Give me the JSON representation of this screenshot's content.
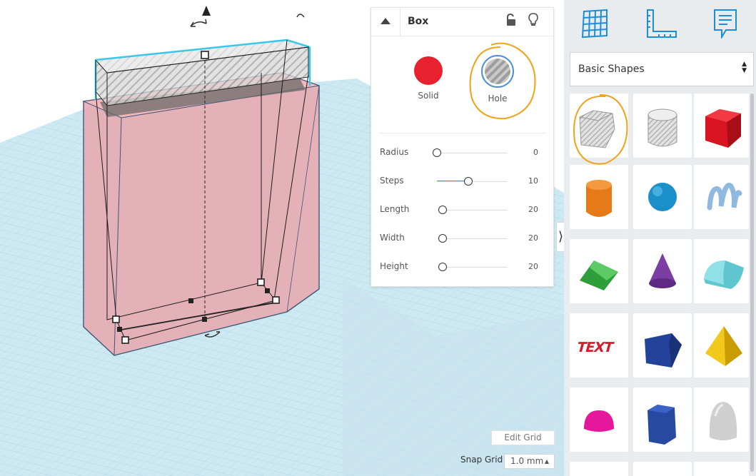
{
  "inspector": {
    "title": "Box",
    "solid_label": "Solid",
    "hole_label": "Hole",
    "colors": {
      "solid": "#e8212f",
      "hole_ring": "#4a90d9",
      "annotation": "#f0a21a"
    },
    "properties": [
      {
        "label": "Radius",
        "value": "0",
        "level": 0.0
      },
      {
        "label": "Steps",
        "value": "10",
        "level": 0.45
      },
      {
        "label": "Length",
        "value": "20",
        "level": 0.08
      },
      {
        "label": "Width",
        "value": "20",
        "level": 0.08
      },
      {
        "label": "Height",
        "value": "20",
        "level": 0.08
      }
    ]
  },
  "workplane": {
    "edit_grid_label": "Edit Grid",
    "snap_grid_label": "Snap Grid",
    "snap_grid_value": "1.0 mm"
  },
  "sidebar": {
    "top_icons": [
      "grid-view-icon",
      "ruler-icon",
      "notes-icon"
    ],
    "shape_category": "Basic Shapes",
    "shapes": [
      {
        "name": "box-hole",
        "icon": "box-hole-icon"
      },
      {
        "name": "cylinder-hole",
        "icon": "cylinder-hole-icon"
      },
      {
        "name": "box",
        "icon": "box-icon",
        "color": "#d7141f"
      },
      {
        "name": "cylinder",
        "icon": "cylinder-icon",
        "color": "#e67a16"
      },
      {
        "name": "sphere",
        "icon": "sphere-icon",
        "color": "#1a8fc9"
      },
      {
        "name": "scribble",
        "icon": "scribble-icon",
        "color": "#8fb9e0"
      },
      {
        "name": "roof",
        "icon": "roof-icon",
        "color": "#2e9e3a"
      },
      {
        "name": "cone",
        "icon": "cone-icon",
        "color": "#7b3fa3"
      },
      {
        "name": "round-roof",
        "icon": "round-roof-icon",
        "color": "#5fc5cf"
      },
      {
        "name": "text",
        "icon": "text-icon",
        "color": "#d01e2a"
      },
      {
        "name": "wedge",
        "icon": "wedge-icon",
        "color": "#23439a"
      },
      {
        "name": "pyramid",
        "icon": "pyramid-icon",
        "color": "#f2c81b"
      },
      {
        "name": "half-sphere",
        "icon": "half-sphere-icon",
        "color": "#e5179a"
      },
      {
        "name": "polygon",
        "icon": "polygon-icon",
        "color": "#274aa0"
      },
      {
        "name": "paraboloid",
        "icon": "paraboloid-icon",
        "color": "#cfcfcf"
      }
    ]
  }
}
